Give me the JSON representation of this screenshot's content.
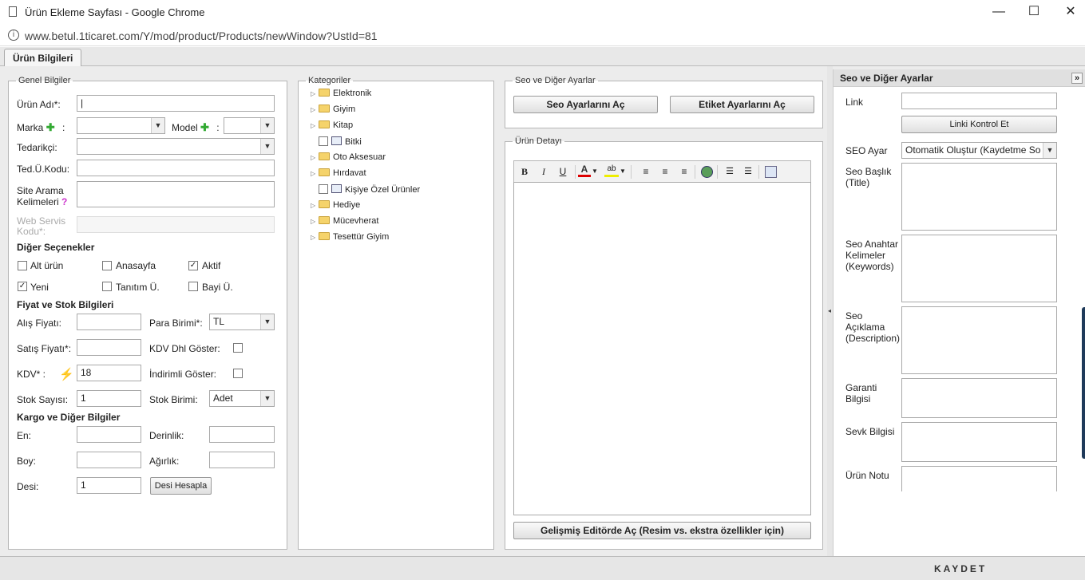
{
  "window": {
    "title": "Ürün Ekleme Sayfası - Google Chrome",
    "url": "www.betul.1ticaret.com/Y/mod/product/Products/newWindow?UstId=81",
    "minimize": "—",
    "maximize": "☐",
    "close": "✕"
  },
  "tab": {
    "label": "Ürün Bilgileri"
  },
  "general": {
    "legend": "Genel Bilgiler",
    "urun_adi_label": "Ürün Adı*:",
    "urun_adi_value": "|",
    "marka_label": "Marka",
    "model_label": "Model",
    "colon": ":",
    "plus": "✚",
    "tedarikci_label": "Tedarikçi:",
    "ted_kodu_label": "Ted.Ü.Kodu:",
    "site_arama_label1": "Site Arama",
    "site_arama_label2": "Kelimeleri",
    "help_mark": "?",
    "web_servis_label1": "Web Servis",
    "web_servis_label2": "Kodu*:",
    "diger_title": "Diğer Seçenekler",
    "opt_alt_urun": "Alt ürün",
    "opt_anasayfa": "Anasayfa",
    "opt_aktif": "Aktif",
    "opt_yeni": "Yeni",
    "opt_tanitim": "Tanıtım Ü.",
    "opt_bayi": "Bayi Ü.",
    "check_mark": "✓",
    "fiyat_title": "Fiyat ve Stok Bilgileri",
    "alis_label": "Alış Fiyatı:",
    "para_label": "Para Birimi*:",
    "para_value": "TL",
    "satis_label": "Satış Fiyatı*:",
    "kdv_dhl_label": "KDV Dhl Göster:",
    "kdv_label": "KDV* :",
    "kdv_value": "18",
    "indirimli_label": "İndirimli Göster:",
    "stok_label": "Stok Sayısı:",
    "stok_value": "1",
    "stok_birim_label": "Stok Birimi:",
    "stok_birim_value": "Adet",
    "kargo_title": "Kargo ve Diğer Bilgiler",
    "en_label": "En:",
    "derinlik_label": "Derinlik:",
    "boy_label": "Boy:",
    "agirlik_label": "Ağırlık:",
    "desi_label": "Desi:",
    "desi_value": "1",
    "desi_button": "Desi Hesapla",
    "arrow": "▼"
  },
  "categories": {
    "legend": "Kategoriler",
    "items": [
      {
        "label": "Elektronik",
        "kind": "folder"
      },
      {
        "label": "Giyim",
        "kind": "folder"
      },
      {
        "label": "Kitap",
        "kind": "folder"
      },
      {
        "label": "Bitki",
        "kind": "leaf"
      },
      {
        "label": "Oto Aksesuar",
        "kind": "folder"
      },
      {
        "label": "Hırdavat",
        "kind": "folder"
      },
      {
        "label": "Kişiye Özel Ürünler",
        "kind": "leaf"
      },
      {
        "label": "Hediye",
        "kind": "folder"
      },
      {
        "label": "Mücevherat",
        "kind": "folder"
      },
      {
        "label": "Tesettür Giyim",
        "kind": "folder"
      }
    ],
    "expander": "▷"
  },
  "seo_box": {
    "legend": "Seo ve Diğer Ayarlar",
    "seo_button": "Seo Ayarlarını Aç",
    "etiket_button": "Etiket Ayarlarını Aç"
  },
  "detail": {
    "legend": "Ürün Detayı",
    "bold": "B",
    "italic": "I",
    "underline": "U",
    "fontcolor": "A",
    "highlight": "ab",
    "advanced_button": "Gelişmiş Editörde Aç (Resim vs. ekstra özellikler için)"
  },
  "right": {
    "title": "Seo ve Diğer Ayarlar",
    "collapse": "»",
    "link_label": "Link",
    "link_check_button": "Linki Kontrol Et",
    "seo_ayar_label": "SEO Ayar",
    "seo_ayar_value": "Otomatik Oluştur (Kaydetme So",
    "seo_baslik_label1": "Seo Başlık",
    "seo_baslik_label2": "(Title)",
    "seo_anahtar_label1": "Seo Anahtar",
    "seo_anahtar_label2": "Kelimeler",
    "seo_anahtar_label3": "(Keywords)",
    "seo_aciklama_label1": "Seo",
    "seo_aciklama_label2": "Açıklama",
    "seo_aciklama_label3": "(Description)",
    "garanti_label1": "Garanti",
    "garanti_label2": "Bilgisi",
    "sevk_label": "Sevk Bilgisi",
    "not_label": "Ürün Notu"
  },
  "footer": {
    "save": "KAYDET"
  }
}
